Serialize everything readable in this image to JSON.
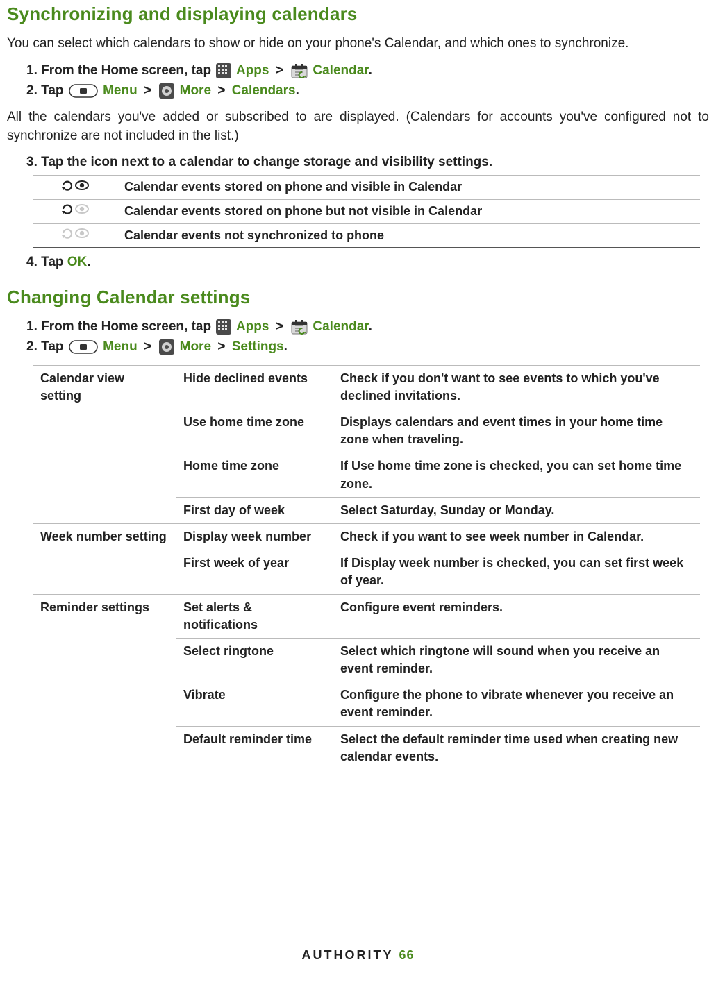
{
  "accent": "#4a8a1d",
  "sec1": {
    "title": "Synchronizing and displaying calendars",
    "intro": "You can select which calendars to show or hide on your phone's Calendar, and which ones to synchronize.",
    "step1_pre": "From the Home screen, tap ",
    "apps": "Apps",
    "gt": ">",
    "calendar": "Calendar",
    "period": ".",
    "step2_pre": "Tap ",
    "menu": "Menu",
    "more": "More",
    "calendars": "Calendars",
    "after": "All the calendars you've added or subscribed to are displayed. (Calendars for accounts you've configured not to synchronize are not included in the list.)",
    "step3": "Tap the icon next to a calendar to change storage and visibility settings.",
    "vis_rows": [
      "Calendar events stored on phone and visible in Calendar",
      "Calendar events stored on phone but not visible in Calendar",
      "Calendar events not synchronized to phone"
    ],
    "step4_pre": "Tap ",
    "ok": "OK"
  },
  "sec2": {
    "title": "Changing Calendar settings",
    "step1_pre": "From the Home screen, tap ",
    "apps": "Apps",
    "gt": ">",
    "calendar": "Calendar",
    "step2_pre": "Tap ",
    "menu": "Menu",
    "more": "More",
    "settings": "Settings",
    "period": ".",
    "groups": [
      {
        "name": "Calendar view setting",
        "rows": [
          {
            "k": "Hide declined events",
            "v": "Check if you don't want to see events to which you've declined invitations."
          },
          {
            "k": "Use home time zone",
            "v": "Displays calendars and event times in your home time zone when traveling."
          },
          {
            "k": "Home time zone",
            "v": "If Use home time zone is checked, you can set home time zone."
          },
          {
            "k": "First day of week",
            "v": "Select Saturday, Sunday or Monday."
          }
        ]
      },
      {
        "name": "Week number setting",
        "rows": [
          {
            "k": "Display week number",
            "v": "Check if you want to see week number in Calendar."
          },
          {
            "k": "First week of year",
            "v": "If Display week number is checked, you can set first week of year."
          }
        ]
      },
      {
        "name": "Reminder settings",
        "rows": [
          {
            "k": "Set alerts & notifications",
            "v": "Configure event reminders."
          },
          {
            "k": "Select ringtone",
            "v": "Select which ringtone will sound when you receive an event reminder."
          },
          {
            "k": "Vibrate",
            "v": "Configure the phone to vibrate whenever you receive an event reminder."
          },
          {
            "k": "Default reminder time",
            "v": "Select the default reminder time used when creating new calendar events."
          }
        ]
      }
    ]
  },
  "footer": {
    "brand": "AUTHORITY",
    "page": "66"
  }
}
